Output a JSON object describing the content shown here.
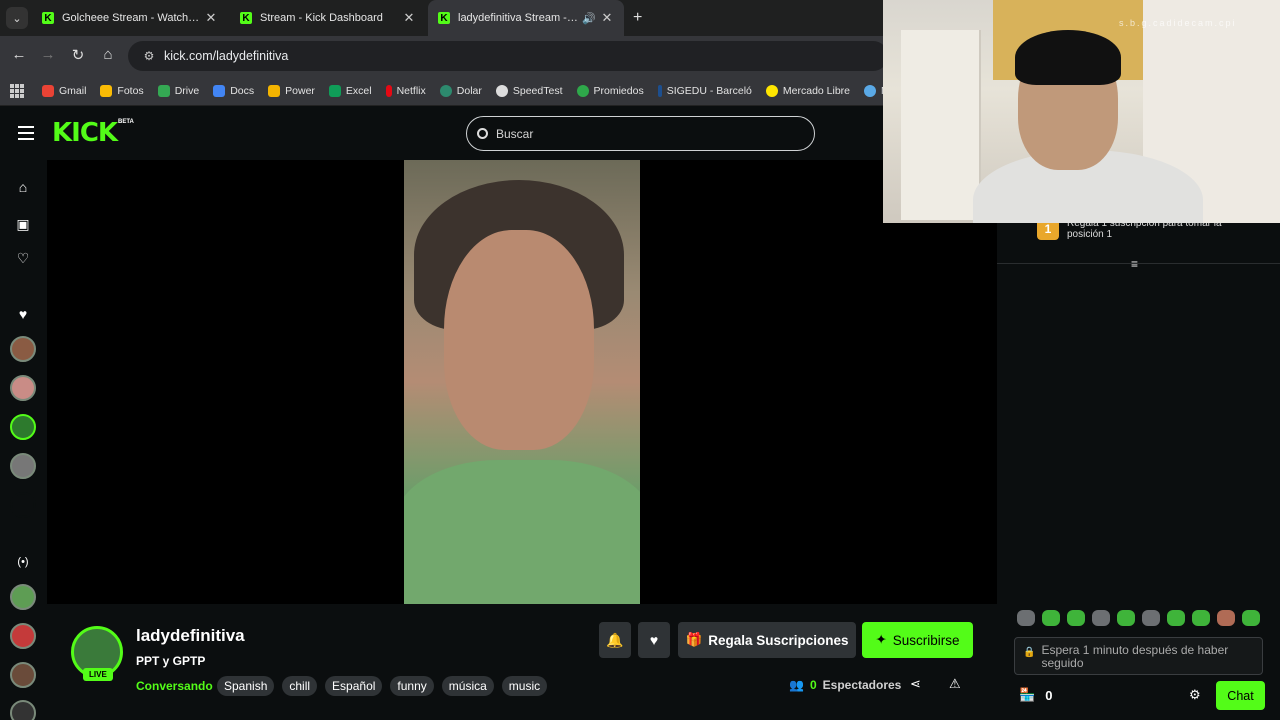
{
  "browser": {
    "tabs": [
      {
        "title": "Golcheee Stream - Watch Live on",
        "active": false
      },
      {
        "title": "Stream - Kick Dashboard",
        "active": false
      },
      {
        "title": "ladydefinitiva Stream - Watc",
        "active": true
      }
    ],
    "url": "kick.com/ladydefinitiva",
    "bookmarks": [
      "Gmail",
      "Fotos",
      "Drive",
      "Docs",
      "Power",
      "Excel",
      "Netflix",
      "Dolar",
      "SpeedTest",
      "Promiedos",
      "SIGEDU - Barceló",
      "Mercado Libre",
      "M"
    ]
  },
  "header": {
    "logo": "KICK",
    "beta": "BETA",
    "search_placeholder": "Buscar"
  },
  "stream": {
    "channel_name": "ladydefinitiva",
    "live_label": "LIVE",
    "title": "PPT y GPTP",
    "category": "Conversando",
    "tags": [
      "Spanish",
      "chill",
      "Español",
      "funny",
      "música",
      "music"
    ],
    "gift_button": "Regala Suscripciones",
    "subscribe_button": "Suscribirse",
    "viewers_count": "0",
    "viewers_label": "Espectadores"
  },
  "chat": {
    "pinned_rank": "1",
    "pinned_text": "Regala 1 suscripción para tomar la posición 1",
    "input_placeholder": "Espera 1 minuto después de haber seguido",
    "store_count": "0",
    "send_label": "Chat"
  },
  "webcam": {
    "watermark": "s.b.g.cadidecam.cpi"
  },
  "colors": {
    "accent": "#53fc18",
    "background": "#0b0e0f"
  }
}
